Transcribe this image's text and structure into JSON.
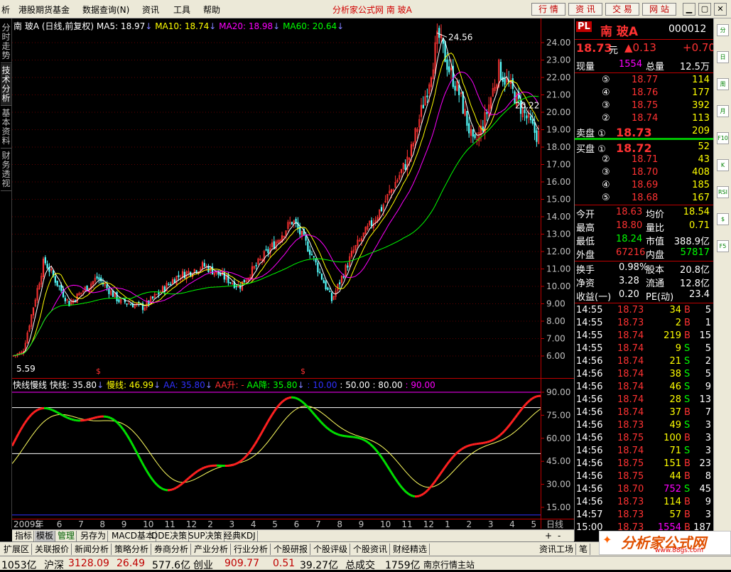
{
  "menu": {
    "items": [
      "析",
      "港股期货基金",
      "数据查询(N)",
      "资讯",
      "工具",
      "帮助"
    ],
    "title": "分析家公式网  南  玻A",
    "buttons": [
      "行 情",
      "资 讯",
      "交 易",
      "网 站"
    ]
  },
  "left_tabs": [
    "分时走势",
    "技术分析",
    "基本资料",
    "财务透视"
  ],
  "chart": {
    "header": {
      "name": "南  玻A",
      "mode": "(日线,前复权)",
      "ma5": "MA5: 18.97",
      "ma10": "MA10: 18.74",
      "ma20": "MA20: 18.98",
      "ma60": "MA60: 20.64"
    },
    "price_axis": [
      "24.00",
      "23.00",
      "22.00",
      "21.00",
      "20.00",
      "19.00",
      "18.00",
      "17.00",
      "16.00",
      "15.00",
      "14.00",
      "13.00",
      "12.00",
      "11.00",
      "10.00",
      "9.00",
      "8.00",
      "7.00",
      "6.00"
    ],
    "high_marker": "24.56",
    "low_marker": "5.59",
    "ma60_marker": "20.22",
    "period": "日线",
    "ind_header": {
      "name": "快线慢线",
      "fast": "快线: 35.80",
      "slow": "慢线: 46.99",
      "aa": "AA: 35.80",
      "aa_up": "AA升: -",
      "aa_down": "AA降: 35.80",
      "l10": ": 10.00",
      "l50": ": 50.00",
      "l80": ": 80.00",
      "l90": ": 90.00"
    },
    "ind_axis": [
      "90.00",
      "75.00",
      "60.00",
      "45.00",
      "30.00",
      "15.00"
    ],
    "date_axis": [
      "2009年",
      "5",
      "6",
      "7",
      "8",
      "9",
      "10",
      "11",
      "12",
      "2",
      "3",
      "4",
      "5",
      "6",
      "7",
      "8",
      "9",
      "10",
      "11",
      "12",
      "1",
      "2",
      "3",
      "4",
      "5"
    ],
    "series_colors": {
      "up": "#ff3232",
      "down": "#54ffff",
      "ma5": "#ffffff",
      "ma10": "#ffff00",
      "ma20": "#ff00ff",
      "ma60": "#00ff00"
    }
  },
  "quote": {
    "code": "000012",
    "name": "南  玻A",
    "badge": "PL",
    "price": "18.73",
    "unit": "元",
    "change": "▲0.13",
    "pct": "+0.70",
    "volume_label": "现量",
    "volume": "1554",
    "total_label": "总量",
    "total": "12.5万",
    "sell": [
      {
        "label": "⑤",
        "price": "18.77",
        "vol": "114"
      },
      {
        "label": "④",
        "price": "18.76",
        "vol": "177"
      },
      {
        "label": "③",
        "price": "18.75",
        "vol": "392"
      },
      {
        "label": "②",
        "price": "18.74",
        "vol": "113"
      },
      {
        "label": "卖盘 ①",
        "price": "18.73",
        "vol": "209"
      }
    ],
    "buy": [
      {
        "label": "买盘 ①",
        "price": "18.72",
        "vol": "52"
      },
      {
        "label": "②",
        "price": "18.71",
        "vol": "43"
      },
      {
        "label": "③",
        "price": "18.70",
        "vol": "408"
      },
      {
        "label": "④",
        "price": "18.69",
        "vol": "185"
      },
      {
        "label": "⑤",
        "price": "18.68",
        "vol": "167"
      }
    ],
    "stats": [
      {
        "l1": "今开",
        "v1": "18.63",
        "l2": "均价",
        "v2": "18.54"
      },
      {
        "l1": "最高",
        "v1": "18.80",
        "l2": "量比",
        "v2": "0.71"
      },
      {
        "l1": "最低",
        "v1": "18.24",
        "l2": "市值",
        "v2": "388.9亿"
      },
      {
        "l1": "外盘",
        "v1": "67216",
        "l2": "内盘",
        "v2": "57817"
      }
    ],
    "fin": [
      {
        "l1": "换手",
        "v1": "0.98%",
        "l2": "股本",
        "v2": "20.8亿"
      },
      {
        "l1": "净资",
        "v1": "3.28",
        "l2": "流通",
        "v2": "12.8亿"
      },
      {
        "l1": "收益(一)",
        "v1": "0.20",
        "l2": "PE(动)",
        "v2": "23.4"
      }
    ],
    "ticks": [
      {
        "t": "14:55",
        "p": "18.73",
        "v": "34",
        "bs": "B",
        "n": "5"
      },
      {
        "t": "14:55",
        "p": "18.73",
        "v": "2",
        "bs": "B",
        "n": "1"
      },
      {
        "t": "14:55",
        "p": "18.74",
        "v": "219",
        "bs": "B",
        "n": "15"
      },
      {
        "t": "14:55",
        "p": "18.74",
        "v": "9",
        "bs": "S",
        "n": "5"
      },
      {
        "t": "14:56",
        "p": "18.74",
        "v": "21",
        "bs": "S",
        "n": "2"
      },
      {
        "t": "14:56",
        "p": "18.74",
        "v": "38",
        "bs": "S",
        "n": "5"
      },
      {
        "t": "14:56",
        "p": "18.74",
        "v": "46",
        "bs": "S",
        "n": "9"
      },
      {
        "t": "14:56",
        "p": "18.74",
        "v": "28",
        "bs": "S",
        "n": "13"
      },
      {
        "t": "14:56",
        "p": "18.74",
        "v": "37",
        "bs": "B",
        "n": "7"
      },
      {
        "t": "14:56",
        "p": "18.73",
        "v": "49",
        "bs": "S",
        "n": "3"
      },
      {
        "t": "14:56",
        "p": "18.75",
        "v": "100",
        "bs": "B",
        "n": "3"
      },
      {
        "t": "14:56",
        "p": "18.74",
        "v": "71",
        "bs": "S",
        "n": "3"
      },
      {
        "t": "14:56",
        "p": "18.75",
        "v": "151",
        "bs": "B",
        "n": "23"
      },
      {
        "t": "14:56",
        "p": "18.75",
        "v": "44",
        "bs": "B",
        "n": "8"
      },
      {
        "t": "14:56",
        "p": "18.70",
        "v": "752",
        "bs": "S",
        "n": "45"
      },
      {
        "t": "14:56",
        "p": "18.73",
        "v": "114",
        "bs": "B",
        "n": "9"
      },
      {
        "t": "14:57",
        "p": "18.73",
        "v": "57",
        "bs": "B",
        "n": "3"
      },
      {
        "t": "15:00",
        "p": "18.73",
        "v": "1554",
        "bs": "B",
        "n": "187"
      }
    ]
  },
  "bottom_tabs": [
    "指标",
    "模板",
    "管理",
    "另存为",
    "MACD基本",
    "DDE决策",
    "SUP决策",
    "经典KDJ"
  ],
  "bottom_controls": [
    "+",
    "-"
  ],
  "nav_tabs": [
    "扩展区",
    "关联报价",
    "新闻分析",
    "策略分析",
    "券商分析",
    "产业分析",
    "行业分析",
    "个股研报",
    "个股评级",
    "个股资讯",
    "财经精选",
    "资讯工场",
    "笔"
  ],
  "status": {
    "s1": "1053亿",
    "s2": "沪深",
    "s3": "3128.09",
    "s4": "26.49",
    "s5": "577.6亿",
    "s6": "创业",
    "s7": "909.77",
    "s8": "0.51",
    "s9": "39.27亿",
    "s10": "总成交",
    "s11": "1759亿",
    "s12": "南京行情主站"
  },
  "logo": {
    "text": "分析家公式网",
    "url": "www.88gs.com"
  },
  "tools": [
    "分",
    "日",
    "周",
    "月",
    "F10",
    "K",
    "RSI",
    "$",
    "F5"
  ]
}
